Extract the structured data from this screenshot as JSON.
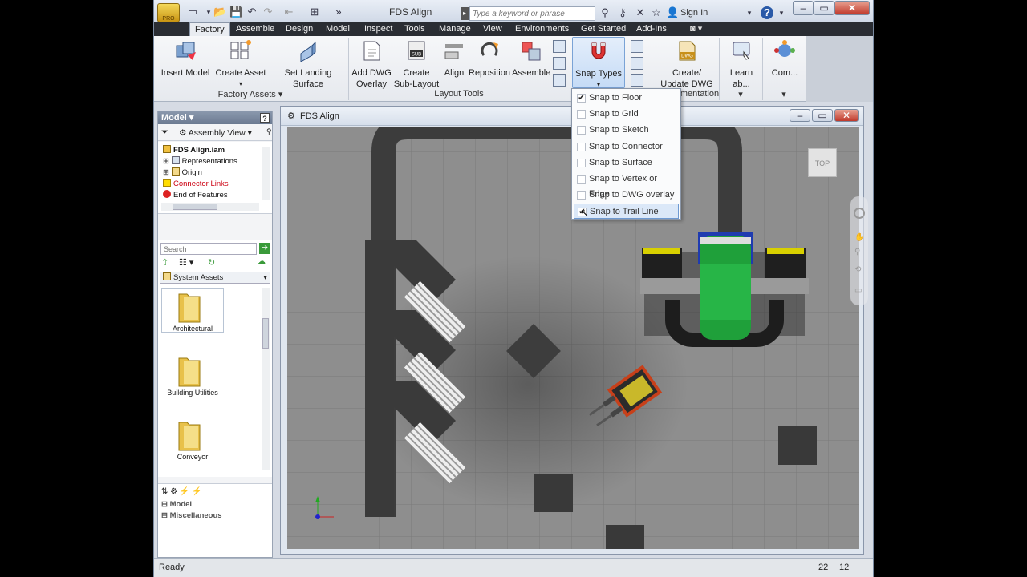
{
  "titlebar": {
    "app_title": "FDS Align",
    "search_placeholder": "Type a keyword or phrase",
    "sign_in": "Sign In",
    "pro_badge": "PRO"
  },
  "tabs": [
    "Factory",
    "Assemble",
    "Design",
    "Model",
    "Inspect",
    "Tools",
    "Manage",
    "View",
    "Environments",
    "Get Started",
    "Add-Ins"
  ],
  "active_tab": "Factory",
  "ribbon": {
    "insert_model": "Insert Model",
    "create_asset": "Create Asset",
    "set_landing_surface": "Set Landing Surface",
    "factory_assets_label": "Factory Assets",
    "add_dwg_overlay_1": "Add DWG",
    "add_dwg_overlay_2": "Overlay",
    "create_sublayout_1": "Create",
    "create_sublayout_2": "Sub-Layout",
    "sub_badge": "SUB",
    "align": "Align",
    "reposition": "Reposition",
    "assemble": "Assemble",
    "layout_tools_label": "Layout Tools",
    "snap_types": "Snap Types",
    "create_update_dwg_1": "Create/",
    "create_update_dwg_2": "Update DWG",
    "dwg_badge": "DWG",
    "documentation_label": "mentation",
    "learn_about": "Learn ab...",
    "community": "Com..."
  },
  "snap_menu": [
    {
      "label": "Snap to Floor",
      "checked": true
    },
    {
      "label": "Snap to Grid",
      "checked": false
    },
    {
      "label": "Snap to Sketch",
      "checked": false
    },
    {
      "label": "Snap to Connector",
      "checked": false
    },
    {
      "label": "Snap to Surface",
      "checked": false
    },
    {
      "label": "Snap to Vertex or Edge",
      "checked": false
    },
    {
      "label": "Snap to DWG overlay",
      "checked": false
    },
    {
      "label": "Snap to Trail Line",
      "checked": true
    }
  ],
  "model_panel": {
    "title": "Model",
    "view_selector": "Assembly View",
    "tree": [
      "FDS Align.iam",
      "Representations",
      "Origin",
      "Connector Links",
      "End of Features"
    ]
  },
  "asset_browser": {
    "search_placeholder": "Search",
    "library": "System Assets",
    "folders": [
      "Architectural",
      "Building Utilities",
      "Conveyor"
    ]
  },
  "properties": {
    "sections": [
      "Model",
      "Miscellaneous"
    ]
  },
  "viewport": {
    "title": "FDS Align",
    "viewcube_label": "TOP"
  },
  "status": {
    "text": "Ready",
    "count1": "22",
    "count2": "12"
  },
  "colors": {
    "accent": "#2b6fc2",
    "ribbon_bg": "#eef0f3",
    "tab_bar": "#2a2d33",
    "floor": "#8b8b8b"
  }
}
